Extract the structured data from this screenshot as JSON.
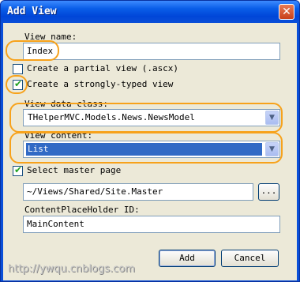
{
  "window": {
    "title": "Add View"
  },
  "form": {
    "view_name_label": "View name:",
    "view_name_value": "Index",
    "partial_view_label": "Create a partial view (.ascx)",
    "strongly_typed_label": "Create a strongly-typed view",
    "view_data_class_label": "View data class:",
    "view_data_class_value": "THelperMVC.Models.News.NewsModel",
    "view_content_label": "View content:",
    "view_content_value": "List",
    "master_page_label": "Select master page",
    "master_page_value": "~/Views/Shared/Site.Master",
    "browse_label": "...",
    "placeholder_label": "ContentPlaceHolder ID:",
    "placeholder_value": "MainContent"
  },
  "buttons": {
    "add": "Add",
    "cancel": "Cancel"
  },
  "watermark": "http://ywqu.cnblogs.com",
  "colors": {
    "title_bar": "#0a4fd8",
    "highlight": "#f7a21b",
    "selection": "#316ac5",
    "check": "#21a121"
  }
}
